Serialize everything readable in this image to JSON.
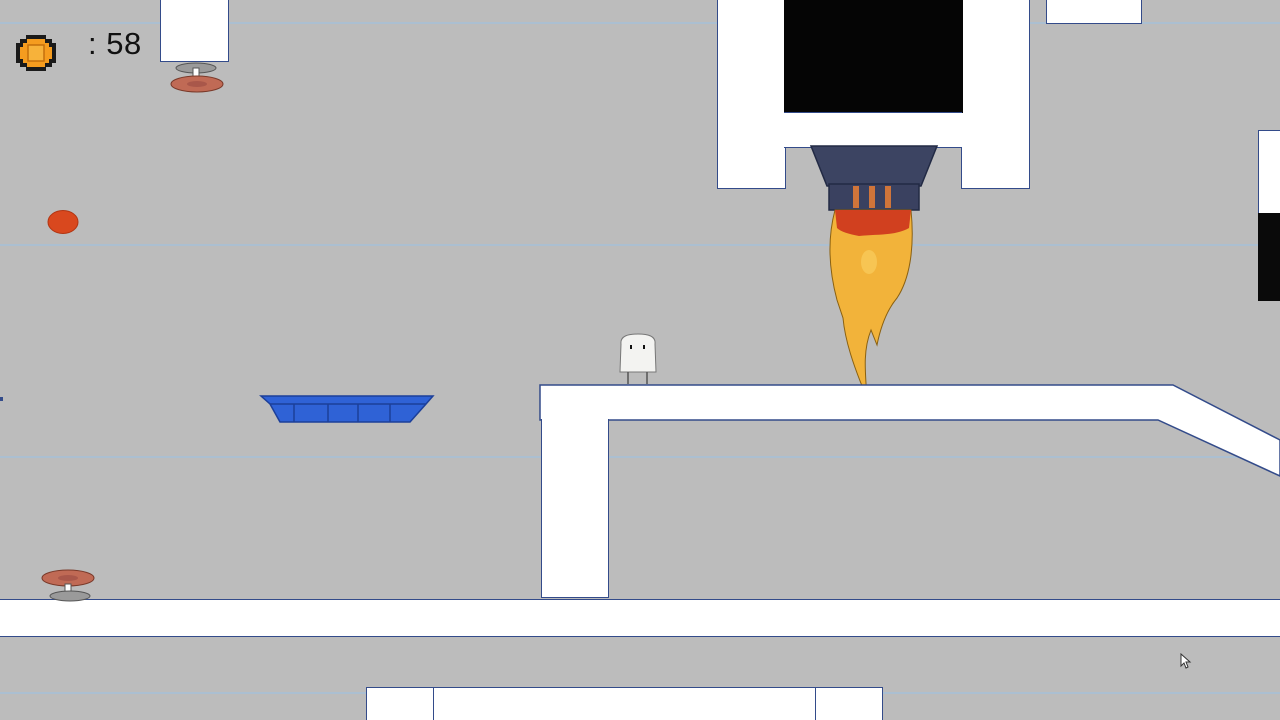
{
  "hud": {
    "coin_icon": "coin-icon",
    "coin_count": ": 58"
  },
  "colors": {
    "background": "#bcbcbc",
    "guide_lines": "#a9bfd3",
    "wall_fill": "#ffffff",
    "wall_outline": "#334b8a",
    "moving_platform": "#2f62d6",
    "flame_outer": "#f2b33a",
    "flame_inner": "#d1401f",
    "thruster_body": "#3c4462",
    "collectible": "#d9481e",
    "coin_fill": "#f59c1f"
  },
  "sprites": {
    "player": "marshmallow-character",
    "hazard": "rocket-thruster-flame",
    "springs": "spring-pad-icon",
    "platform": "blue-moving-platform",
    "pickup": "red-blob-pickup",
    "cursor": "mouse-pointer-icon"
  }
}
